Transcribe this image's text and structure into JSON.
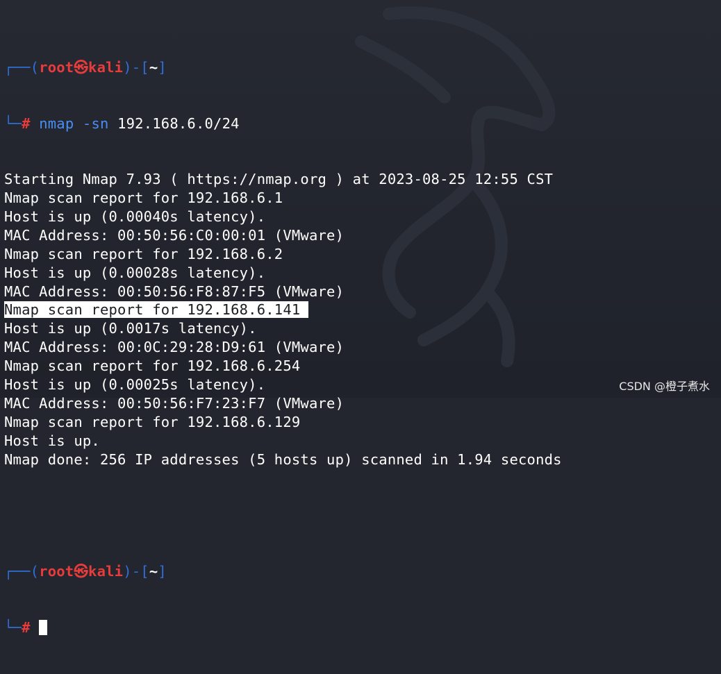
{
  "terminal": {
    "prompt": {
      "frame_left": "┌──(",
      "user": "root",
      "skull": "㉿",
      "host": "kali",
      "frame_mid": ")-[",
      "cwd": "~",
      "frame_right": "]",
      "bottom_prefix": "└─",
      "hash": "#"
    },
    "command": {
      "name": "nmap",
      "flag": "-sn",
      "arg": "192.168.6.0/24"
    },
    "output": [
      "Starting Nmap 7.93 ( https://nmap.org ) at 2023-08-25 12:55 CST",
      "Nmap scan report for 192.168.6.1",
      "Host is up (0.00040s latency).",
      "MAC Address: 00:50:56:C0:00:01 (VMware)",
      "Nmap scan report for 192.168.6.2",
      "Host is up (0.00028s latency).",
      "MAC Address: 00:50:56:F8:87:F5 (VMware)",
      "Nmap scan report for 192.168.6.141",
      "Host is up (0.0017s latency).",
      "MAC Address: 00:0C:29:28:D9:61 (VMware)",
      "Nmap scan report for 192.168.6.254",
      "Host is up (0.00025s latency).",
      "MAC Address: 00:50:56:F7:23:F7 (VMware)",
      "Nmap scan report for 192.168.6.129",
      "Host is up.",
      "Nmap done: 256 IP addresses (5 hosts up) scanned in 1.94 seconds"
    ],
    "highlighted_line_index": 7
  },
  "watermark": "CSDN @橙子煮水",
  "colors": {
    "background": "#23262e",
    "prompt_frame": "#2f6fd6",
    "prompt_user": "#e83b3b",
    "command": "#4a8ef3",
    "text": "#ffffff"
  }
}
